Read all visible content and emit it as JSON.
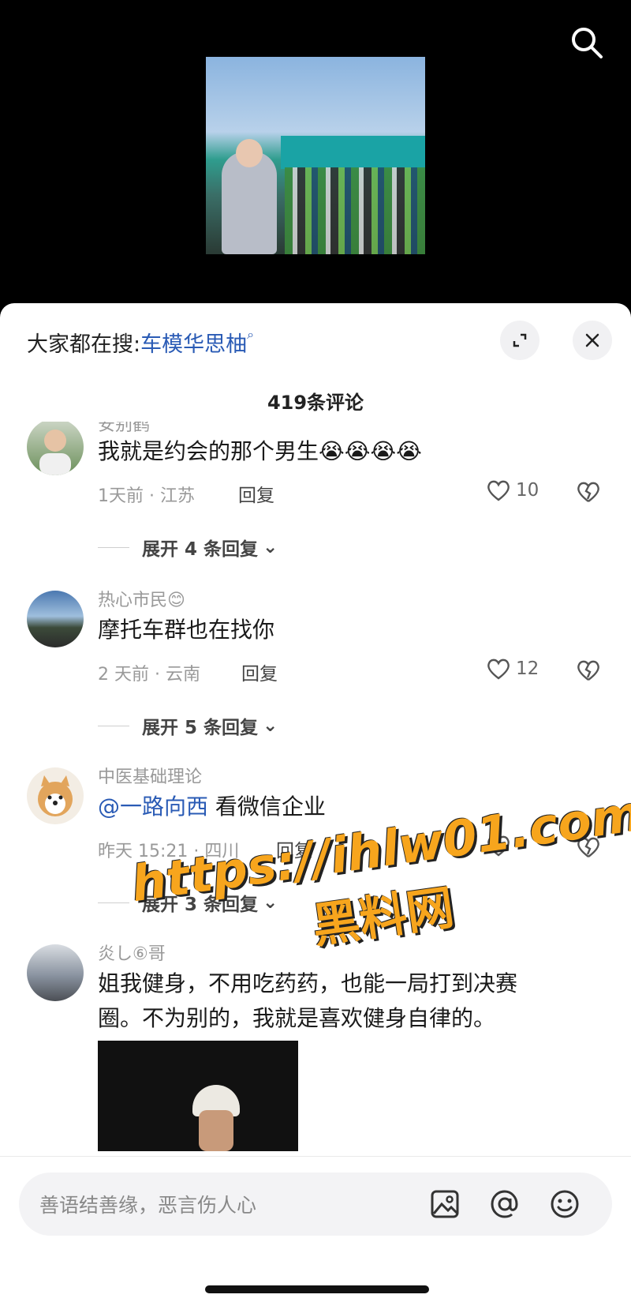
{
  "header": {
    "hot_search_prefix": "大家都在搜:",
    "hot_search_keyword": "车模华思柚",
    "comment_count": "419条评论"
  },
  "comments": [
    {
      "username": "安别鹤",
      "text": "我就是约会的那个男生😭😭😭😭",
      "meta": "1天前 · 江苏",
      "reply_label": "回复",
      "likes": "10",
      "expand_label": "展开 4 条回复"
    },
    {
      "username": "热心市民😊",
      "text": "摩托车群也在找你",
      "meta": "2 天前 · 云南",
      "reply_label": "回复",
      "likes": "12",
      "expand_label": "展开 5 条回复"
    },
    {
      "username": "中医基础理论",
      "mention": "@一路向西",
      "text": " 看微信企业",
      "meta": "昨天 15:21 · 四川",
      "reply_label": "回复",
      "expand_label": "展开 3 条回复"
    },
    {
      "username": "炎し⑥哥",
      "text_line1": "姐我健身，不用吃药药，也能一局打到决赛",
      "text_line2": "圈。不为别的，我就是喜欢健身自律的。"
    }
  ],
  "input": {
    "placeholder": "善语结善缘，恶言伤人心"
  },
  "watermark": {
    "line1": "https://ihlw01.com",
    "line2": "黑料网"
  },
  "icons": {
    "top_search": "search-icon",
    "expand": "expand-icon",
    "close": "close-icon",
    "like": "heart-icon",
    "dislike": "broken-heart-icon",
    "image": "image-icon",
    "mention": "at-icon",
    "emoji": "emoji-icon"
  }
}
